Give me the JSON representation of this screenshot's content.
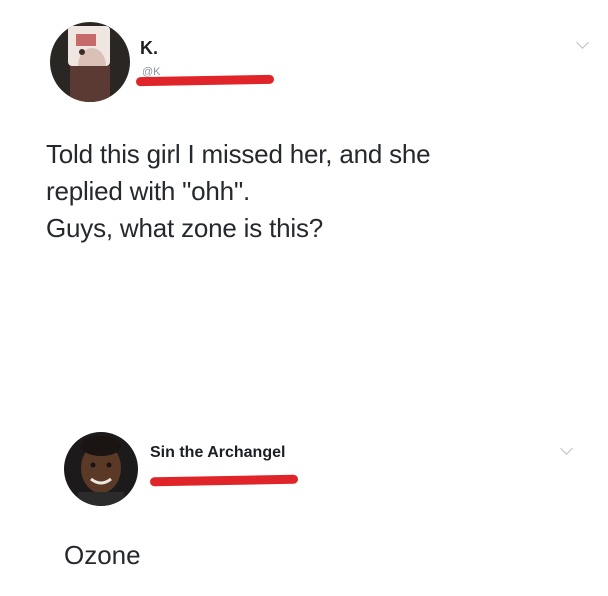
{
  "tweet": {
    "author_name": "K.",
    "author_handle": "@K",
    "text_lines": [
      "Told this girl I missed her, and she",
      "replied with \"ohh\".",
      "Guys, what zone is this?"
    ]
  },
  "reply": {
    "author_name": "Sin the Archangel",
    "text": "Ozone"
  },
  "icons": {
    "tweet_menu": "chevron-down-icon",
    "reply_menu": "chevron-down-icon"
  },
  "colors": {
    "redaction": "#e0252a",
    "text": "#25292e",
    "chevron": "#b9c0c7"
  }
}
